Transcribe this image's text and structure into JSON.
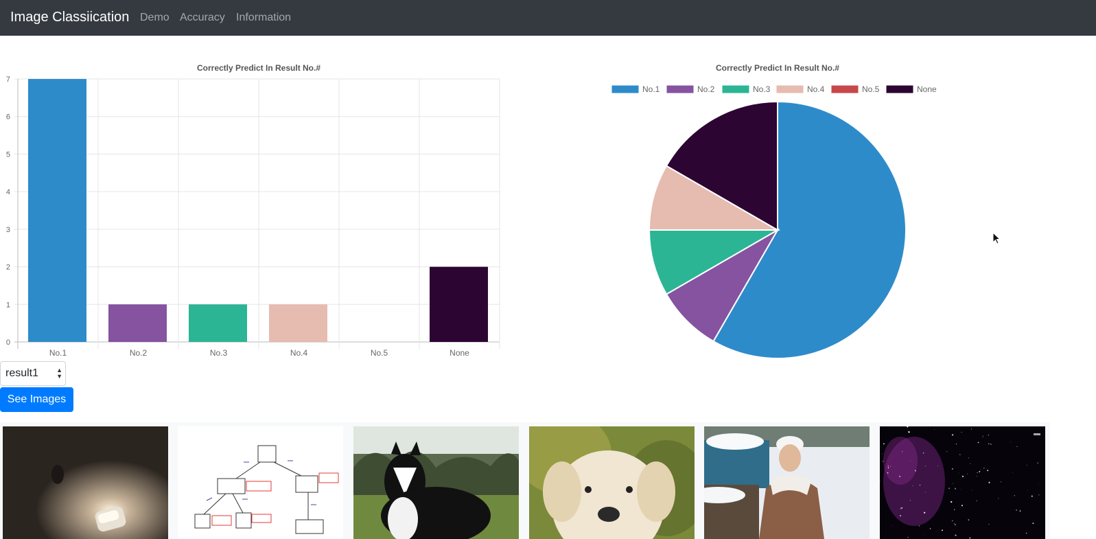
{
  "navbar": {
    "brand": "Image Classiication",
    "links": [
      "Demo",
      "Accuracy",
      "Information"
    ]
  },
  "colors": {
    "navbar_bg": "#343a40",
    "primary": "#007bff",
    "series": [
      "#2e8bca",
      "#8553a0",
      "#2bb594",
      "#e6bbb0",
      "#c7474a",
      "#2d0533"
    ]
  },
  "chart_data": [
    {
      "type": "bar",
      "title": "Correctly Predict In Result No.#",
      "categories": [
        "No.1",
        "No.2",
        "No.3",
        "No.4",
        "No.5",
        "None"
      ],
      "values": [
        7,
        1,
        1,
        1,
        0,
        2
      ],
      "ylim": [
        0,
        7
      ],
      "yticks": [
        "0",
        "1",
        "2",
        "3",
        "4",
        "5",
        "6",
        "7"
      ],
      "grid": true,
      "legend": "none"
    },
    {
      "type": "pie",
      "title": "Correctly Predict In Result No.#",
      "categories": [
        "No.1",
        "No.2",
        "No.3",
        "No.4",
        "No.5",
        "None"
      ],
      "values": [
        7,
        1,
        1,
        1,
        0,
        2
      ],
      "legend": "top"
    }
  ],
  "controls": {
    "select_value": "result1",
    "see_images_label": "See Images"
  },
  "gallery": {
    "images": [
      "lamp-icon",
      "diagram-icon",
      "dog-icon",
      "puppy-icon",
      "person-icon",
      "galaxy-icon"
    ]
  }
}
